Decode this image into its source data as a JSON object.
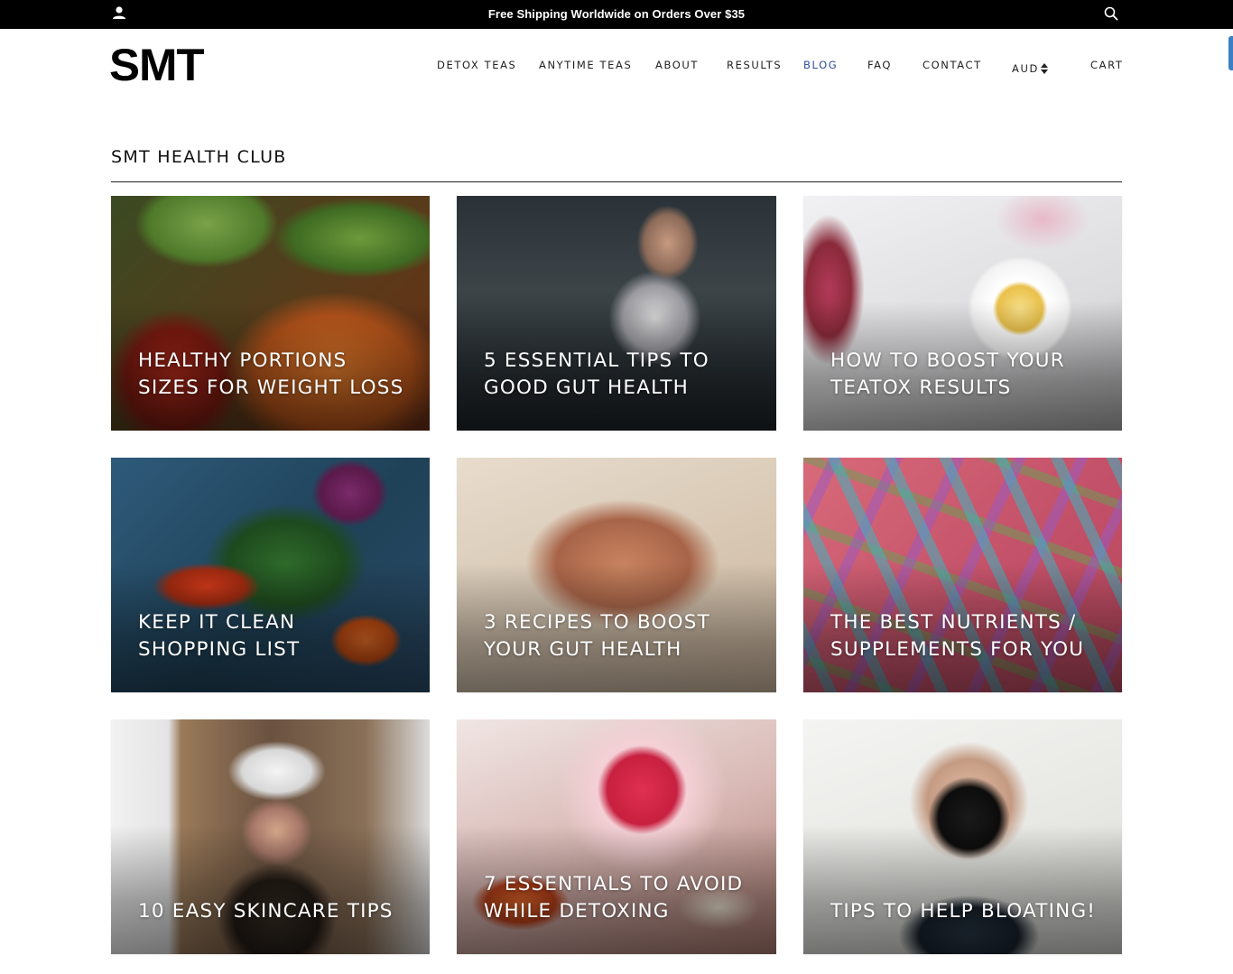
{
  "topbar": {
    "announcement": "Free Shipping Worldwide on Orders Over $35",
    "background": "#000000"
  },
  "header": {
    "logo": "SMT",
    "nav": [
      {
        "label": "DETOX TEAS",
        "active": false
      },
      {
        "label": "ANYTIME TEAS",
        "active": false
      },
      {
        "label": "ABOUT",
        "active": false
      },
      {
        "label": "RESULTS",
        "active": false
      },
      {
        "label": "BLOG",
        "active": true
      },
      {
        "label": "FAQ",
        "active": false
      },
      {
        "label": "CONTACT",
        "active": false
      },
      {
        "label": "AUD",
        "active": false
      },
      {
        "label": "CART",
        "active": false
      }
    ],
    "active_color": "#2f4f8f"
  },
  "page": {
    "title": "SMT HEALTH CLUB"
  },
  "posts": [
    {
      "title": "HEALTHY PORTIONS SIZES FOR WEIGHT LOSS",
      "image": "vegetables-market"
    },
    {
      "title": "5 ESSENTIAL TIPS TO GOOD GUT HEALTH",
      "image": "woman-stretching"
    },
    {
      "title": "HOW TO BOOST YOUR TEATOX RESULTS",
      "image": "lemon-tea-cup"
    },
    {
      "title": "KEEP IT CLEAN SHOPPING LIST",
      "image": "fresh-produce"
    },
    {
      "title": "3 RECIPES TO BOOST YOUR GUT HEALTH",
      "image": "woman-bikini-beach"
    },
    {
      "title": "THE BEST NUTRIENTS / SUPPLEMENTS FOR YOU",
      "image": "glitter-capsules"
    },
    {
      "title": "10 EASY SKINCARE TIPS",
      "image": "woman-towel-mirror"
    },
    {
      "title": "7 ESSENTIALS TO AVOID WHILE DETOXING",
      "image": "red-drink-glass"
    },
    {
      "title": "TIPS TO HELP BLOATING!",
      "image": "woman-sports-bra"
    }
  ]
}
